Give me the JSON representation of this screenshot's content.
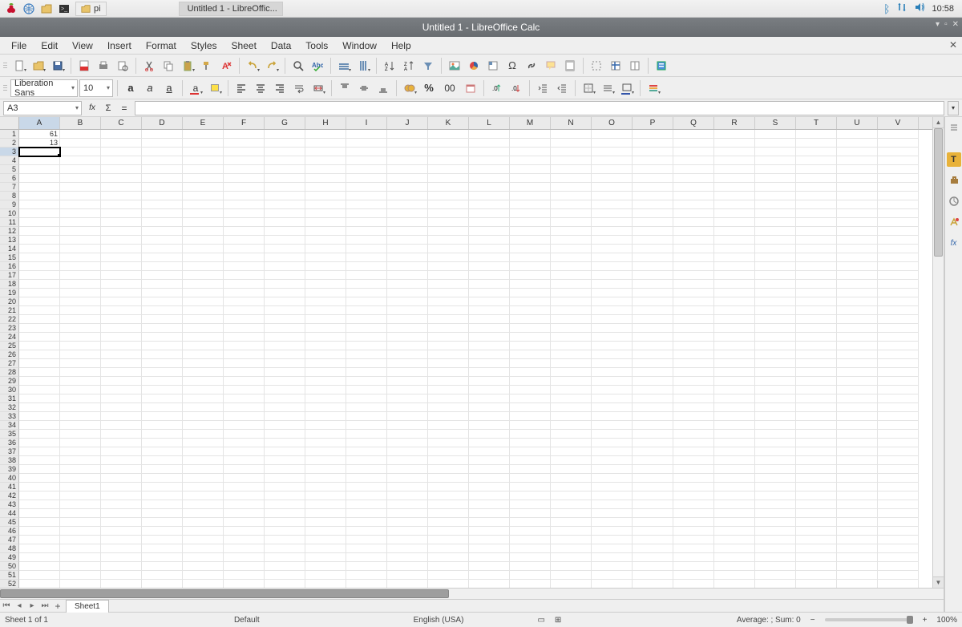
{
  "taskbar": {
    "items": [
      {
        "label": "pi"
      },
      {
        "label": "Untitled 1 - LibreOffic..."
      }
    ],
    "tray": {
      "time": "10:58"
    }
  },
  "titlebar": {
    "title": "Untitled 1 - LibreOffice Calc"
  },
  "menubar": {
    "items": [
      "File",
      "Edit",
      "View",
      "Insert",
      "Format",
      "Styles",
      "Sheet",
      "Data",
      "Tools",
      "Window",
      "Help"
    ]
  },
  "toolbar2": {
    "font_name": "Liberation Sans",
    "font_size": "10",
    "percent": "%",
    "zeros": "00"
  },
  "formulabar": {
    "cell_ref": "A3",
    "fx": "fx",
    "sigma": "Σ",
    "equals": "="
  },
  "grid": {
    "columns": [
      "A",
      "B",
      "C",
      "D",
      "E",
      "F",
      "G",
      "H",
      "I",
      "J",
      "K",
      "L",
      "M",
      "N",
      "O",
      "P",
      "Q",
      "R",
      "S",
      "T",
      "U",
      "V"
    ],
    "row_count": 54,
    "active_col": "A",
    "active_row": 3,
    "cells": {
      "A1": "61",
      "A2": "13"
    }
  },
  "tabs": {
    "sheet1": "Sheet1",
    "add": "+"
  },
  "statusbar": {
    "sheet_info": "Sheet 1 of 1",
    "style": "Default",
    "language": "English (USA)",
    "summary": "Average: ; Sum: 0",
    "zoom": "100%"
  }
}
